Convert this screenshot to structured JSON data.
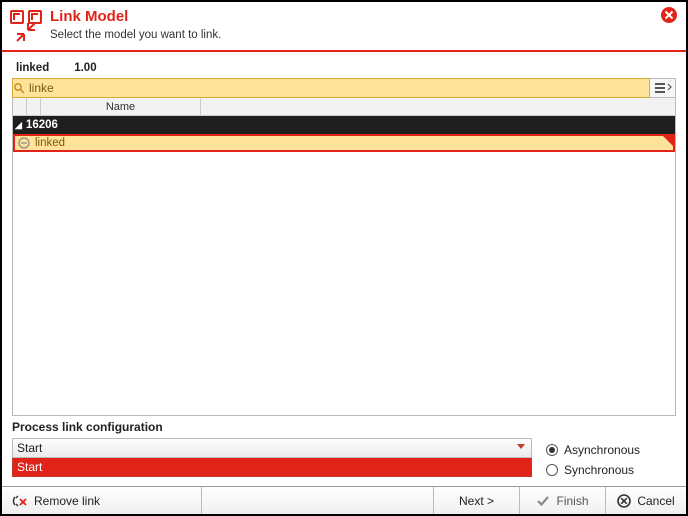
{
  "header": {
    "title": "Link Model",
    "subtitle": "Select the model you want to link."
  },
  "info": {
    "label": "linked",
    "version": "1.00"
  },
  "search": {
    "value": "linke"
  },
  "grid": {
    "columns": {
      "name": "Name"
    },
    "group": "16206",
    "row": {
      "name": "linked"
    }
  },
  "config": {
    "title": "Process link configuration",
    "combo_value": "Start",
    "combo_option": "Start",
    "radios": {
      "async": "Asynchronous",
      "sync": "Synchronous"
    },
    "selected_radio": "async"
  },
  "footer": {
    "remove": "Remove link",
    "next": "Next >",
    "finish": "Finish",
    "cancel": "Cancel"
  }
}
